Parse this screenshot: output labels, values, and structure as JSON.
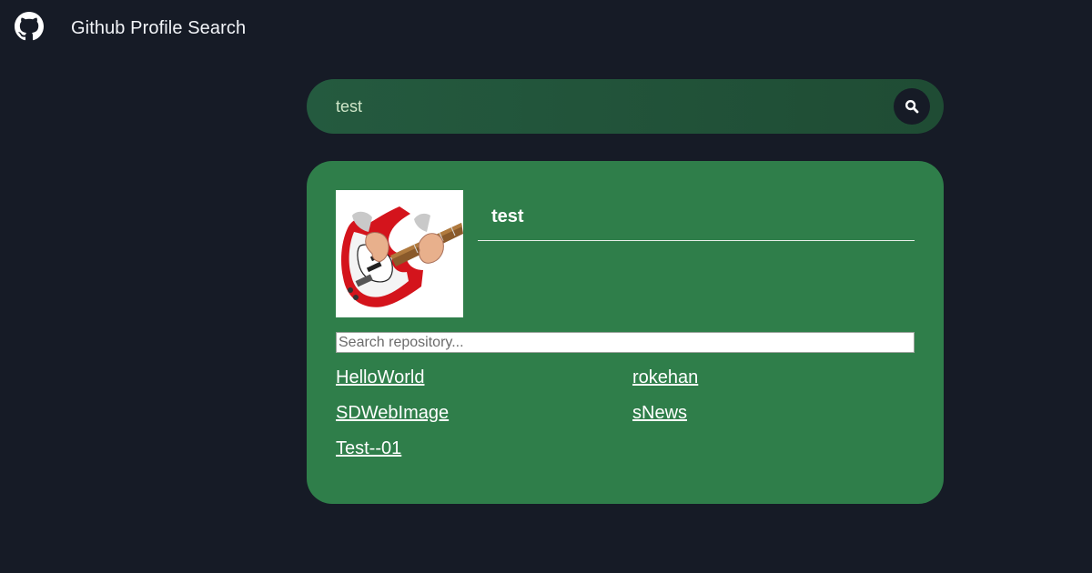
{
  "header": {
    "logo_icon": "github-icon",
    "title": "Github Profile Search"
  },
  "search": {
    "value": "test",
    "button_icon": "search-icon"
  },
  "profile": {
    "username": "test",
    "avatar_icon": "guitar-avatar-image",
    "repo_search_placeholder": "Search repository...",
    "repos": [
      "HelloWorld",
      "rokehan",
      "SDWebImage",
      "sNews",
      "Test--01"
    ]
  },
  "colors": {
    "background": "#161b26",
    "search_bar": "#245a3f",
    "card": "#2f7e4a",
    "text": "#ffffff"
  }
}
